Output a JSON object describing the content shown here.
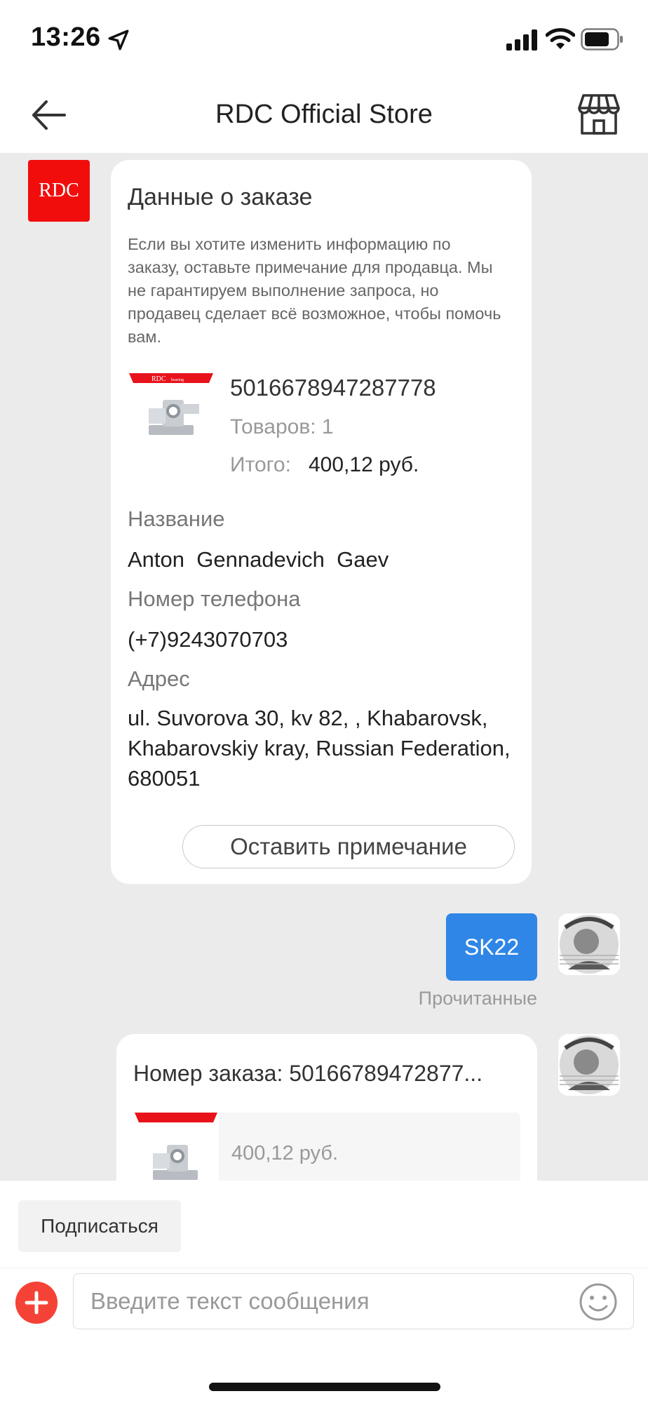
{
  "status_bar": {
    "time": "13:26"
  },
  "header": {
    "title": "RDC Official Store"
  },
  "seller": {
    "avatar_text": "RDC"
  },
  "order_card": {
    "title": "Данные о заказе",
    "note": "Если вы хотите изменить информацию по заказу, оставьте примечание для продавца. Мы не гарантируем выполнение запроса, но продавец сделает всё возможное, чтобы помочь вам.",
    "product_brand": "RDC",
    "product_brand_sub": "bearing",
    "order_number": "5016678947287778",
    "items_count": "Товаров: 1",
    "total_label": "Итого:",
    "total_value": "400,12 руб.",
    "name_label": "Название",
    "name_value": "Anton  Gennadevich  Gaev",
    "phone_label": "Номер телефона",
    "phone_value": "(+7)9243070703",
    "address_label": "Адрес",
    "address_value": "ul. Suvorova 30, kv 82, , Khabarovsk, Khabarovskiy kray, Russian Federation, 680051",
    "note_button": "Оставить примечание"
  },
  "user_message": {
    "text": "SK22",
    "status": "Прочитанные"
  },
  "order_card2": {
    "title": "Номер заказа: 50166789472877...",
    "price": "400,12 руб."
  },
  "bottom": {
    "subscribe_button": "Подписаться",
    "input_placeholder": "Введите текст сообщения"
  },
  "colors": {
    "accent_blue": "#2f86e6",
    "brand_red": "#f20d0d",
    "plus_red": "#f44336"
  }
}
